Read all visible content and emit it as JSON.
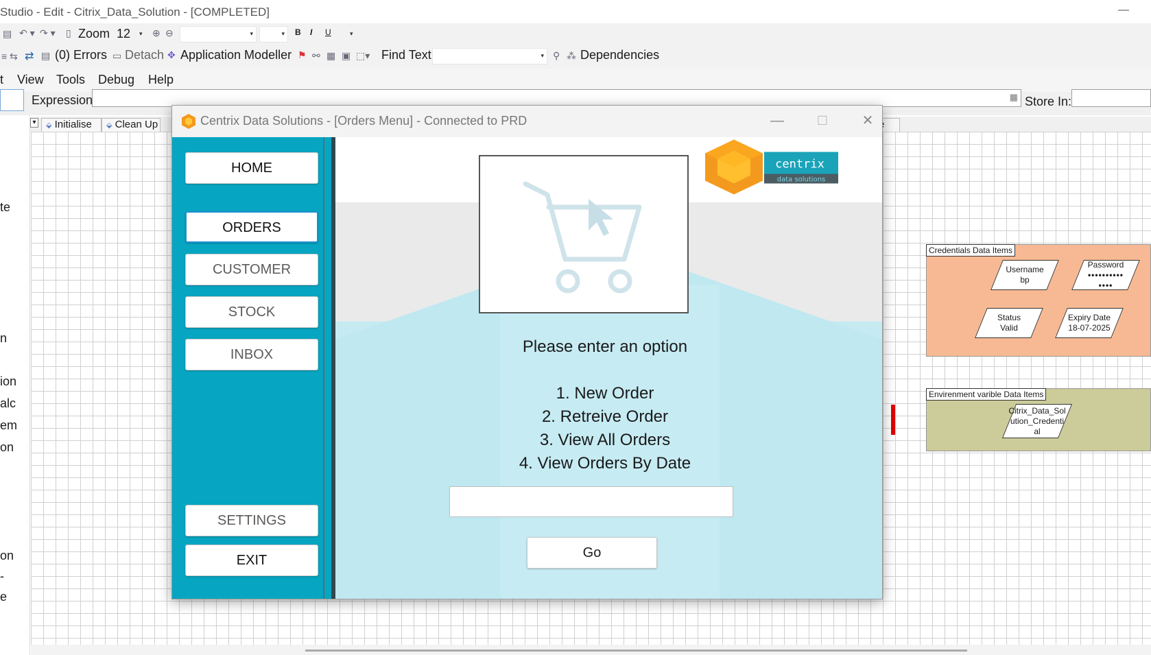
{
  "studio": {
    "title": "Studio  - Edit - Citrix_Data_Solution - [COMPLETED]",
    "minimize": "—",
    "toolbar1": {
      "zoom_label": "Zoom",
      "zoom_value": "12",
      "bold": "B",
      "italic": "I",
      "underline": "U"
    },
    "toolbar2": {
      "errors": "(0) Errors",
      "detach": "Detach",
      "application_modeller": "Application Modeller",
      "find_text": "Find Text",
      "dependencies": "Dependencies"
    },
    "menu": [
      "t",
      "View",
      "Tools",
      "Debug",
      "Help"
    ],
    "expression_label": "Expression:",
    "store_in_label": "Store In:",
    "page_tabs": [
      "Initialise",
      "Clean Up",
      "erminate"
    ],
    "left_pane_fragments": [
      "te",
      "n",
      "ion",
      "alc",
      "em",
      "on",
      "on",
      "-",
      "e"
    ],
    "credentials_block": {
      "label": "Credentials Data Items",
      "items": [
        {
          "name": "Username",
          "value": "bp"
        },
        {
          "name": "Password",
          "value": "••••••••••\n••••"
        },
        {
          "name": "Status",
          "value": "Valid"
        },
        {
          "name": "Expiry Date",
          "value": "18-07-2025"
        }
      ]
    },
    "environment_block": {
      "label": "Envirenment varible Data Items",
      "items": [
        {
          "name": "Citrix_Data_Sol\nution_Credenti\nal"
        }
      ]
    },
    "colors": {
      "credentials_bg": "#f7b993",
      "environment_bg": "#cccc9a"
    }
  },
  "app": {
    "title": "Centrix Data Solutions - [Orders Menu] - Connected to PRD",
    "controls": {
      "minimize": "—",
      "maximize": "☐",
      "close": "✕"
    },
    "nav": {
      "home": "HOME",
      "orders": "ORDERS",
      "customer": "CUSTOMER",
      "stock": "STOCK",
      "inbox": "INBOX",
      "settings": "SETTINGS",
      "exit": "EXIT"
    },
    "logo": {
      "line1": "centrix",
      "line2": "data solutions"
    },
    "prompt": "Please enter an option",
    "options": [
      "1. New Order",
      "2. Retreive Order",
      "3. View All Orders",
      "4. View Orders By Date"
    ],
    "input_value": "",
    "go_label": "Go",
    "colors": {
      "sidebar": "#06a6c2",
      "accent_orange": "#f39a1e",
      "logo_teal": "#1aa3b9"
    }
  }
}
